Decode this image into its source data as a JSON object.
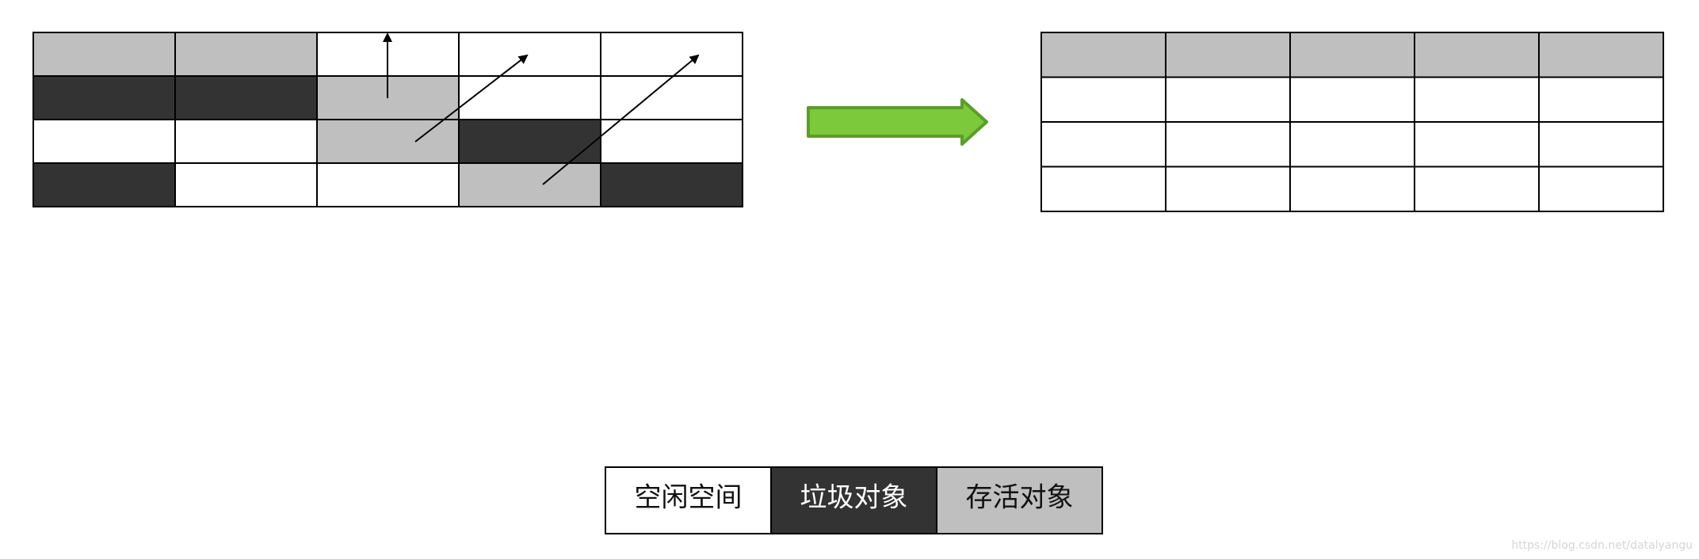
{
  "colors": {
    "free": "#ffffff",
    "garbage": "#333333",
    "live": "#bfbfbf",
    "grid_line": "#000000",
    "arrow_fill": "#7cc93b",
    "arrow_stroke": "#5a9e2a",
    "legend_text_dark": "#111111",
    "legend_text_light": "#ffffff"
  },
  "before_memory": {
    "rows": 4,
    "cols": 5,
    "cells": [
      [
        "live",
        "live",
        "free",
        "free",
        "free"
      ],
      [
        "garbage",
        "garbage",
        "live",
        "free",
        "free"
      ],
      [
        "free",
        "free",
        "live",
        "garbage",
        "free"
      ],
      [
        "garbage",
        "free",
        "free",
        "live",
        "garbage"
      ]
    ],
    "move_arrows": [
      {
        "from": [
          1,
          2
        ],
        "to": [
          0,
          2
        ]
      },
      {
        "from": [
          2,
          2
        ],
        "to": [
          0,
          3
        ]
      },
      {
        "from": [
          3,
          3
        ],
        "to": [
          0,
          4
        ]
      }
    ]
  },
  "transition_arrow": {
    "icon": "right-arrow-icon"
  },
  "after_memory": {
    "rows": 4,
    "cols": 5,
    "cells": [
      [
        "live",
        "live",
        "live",
        "live",
        "live"
      ],
      [
        "free",
        "free",
        "free",
        "free",
        "free"
      ],
      [
        "free",
        "free",
        "free",
        "free",
        "free"
      ],
      [
        "free",
        "free",
        "free",
        "free",
        "free"
      ]
    ]
  },
  "legend": {
    "items": [
      {
        "key": "free",
        "label": "空闲空间"
      },
      {
        "key": "garbage",
        "label": "垃圾对象"
      },
      {
        "key": "live",
        "label": "存活对象"
      }
    ]
  },
  "watermark": {
    "text": "https://blog.csdn.net/datalyangu"
  }
}
